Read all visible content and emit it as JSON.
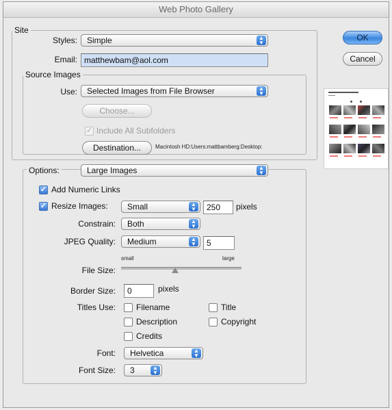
{
  "window": {
    "title": "Web Photo Gallery"
  },
  "buttons": {
    "ok": "OK",
    "cancel": "Cancel"
  },
  "site": {
    "legend": "Site",
    "styles_label": "Styles:",
    "styles_value": "Simple",
    "email_label": "Email:",
    "email_value": "matthewbam@aol.com"
  },
  "source": {
    "legend": "Source Images",
    "use_label": "Use:",
    "use_value": "Selected Images from File Browser",
    "choose_label": "Choose...",
    "include_subfolders_label": "Include All Subfolders",
    "include_subfolders_checked": true,
    "destination_label": "Destination...",
    "destination_path": "Macintosh HD:Users:mattbamberg:Desktop:"
  },
  "options": {
    "legend": "Options:",
    "value": "Large Images",
    "add_numeric_links_label": "Add Numeric Links",
    "add_numeric_links_checked": true,
    "resize_images_label": "Resize Images:",
    "resize_images_checked": true,
    "resize_value": "Small",
    "resize_pixels": "250",
    "pixels_unit": "pixels",
    "constrain_label": "Constrain:",
    "constrain_value": "Both",
    "jpeg_quality_label": "JPEG Quality:",
    "jpeg_quality_value": "Medium",
    "jpeg_quality_number": "5",
    "file_size_label": "File Size:",
    "file_size_small": "small",
    "file_size_large": "large",
    "file_size_position": 0.45,
    "border_size_label": "Border Size:",
    "border_size_value": "0",
    "border_pixels_unit": "pixels",
    "titles_use_label": "Titles Use:",
    "titles_use": {
      "filename": "Filename",
      "description": "Description",
      "credits": "Credits",
      "title": "Title",
      "copyright": "Copyright"
    },
    "font_label": "Font:",
    "font_value": "Helvetica",
    "font_size_label": "Font Size:",
    "font_size_value": "3"
  },
  "icons": {
    "popup_arrow": "updown-arrow-icon",
    "check": "checkmark-icon"
  },
  "colors": {
    "accent": "#3a78d6",
    "highlight": "#cfe0f6"
  }
}
